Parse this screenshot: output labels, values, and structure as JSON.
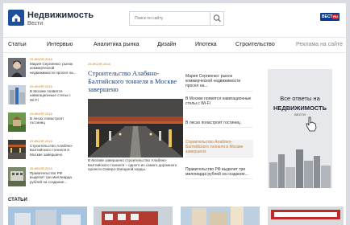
{
  "header": {
    "logo_title": "Недвижимость",
    "logo_sub": "Вести",
    "search_placeholder": "Поиск по сайту",
    "badge_main": "ВЕСТИ",
    "badge_ru": "RU"
  },
  "nav": {
    "items": [
      "Статьи",
      "Интервью",
      "Аналитика рынка",
      "Дизайн",
      "Ипотека",
      "Строительство",
      "Реклама на сайте"
    ]
  },
  "left_news": [
    {
      "date": "25 ИЮЛЯ 2016",
      "text": "Мария Сергиенко: рынок коммерческой недвижимости просел на..."
    },
    {
      "date": "25 ИЮЛЯ 2016",
      "text": "В Москве появятся навигационные стелы с Wi-Fi"
    },
    {
      "date": "25 ИЮЛЯ 2016",
      "text": "В лесах пояастроят гостиниц"
    },
    {
      "date": "25 ИЮЛЯ 2016",
      "text": "Строительство Алабяно-Балтийского тоннеля в Москве завершено"
    },
    {
      "date": "25 ИЮЛЯ 2016",
      "text": "Правительство РФ выделит три миллиарда рублей на создание..."
    }
  ],
  "main": {
    "date": "25 ИЮЛЯ 2016",
    "title": "Строительство Алабяно-Балтийского тоннеля в Москве завершено",
    "text": "В Москве завершено строительство Алабяно-Балтийского тоннеля – одного из самого дорожного проекта Северо-Западной хорды."
  },
  "right_news": [
    {
      "text": "Мария Сергиенко: рынок коммерческой недвижимости просел на...",
      "active": false
    },
    {
      "text": "В Москве появятся навигационные стелы с Wi-Fi",
      "active": false
    },
    {
      "text": "В лесах пояастроят гостиниц",
      "active": false
    },
    {
      "text": "Строительство Алабяно-Балтийского тоннеля в Москве завершено",
      "active": true
    },
    {
      "text": "Правительство РФ выделит три миллиарда рублей на создание...",
      "active": false
    }
  ],
  "ad": {
    "line1": "Все ответы на",
    "line2": "НЕДВИЖИМОСТЬ",
    "line3": "ВЕСТИ"
  },
  "section": {
    "title": "СТАТЬИ"
  },
  "colors": {
    "accent_blue": "#1a3f78",
    "date_orange": "#c47a1f",
    "brand": "#1c4f9c"
  }
}
